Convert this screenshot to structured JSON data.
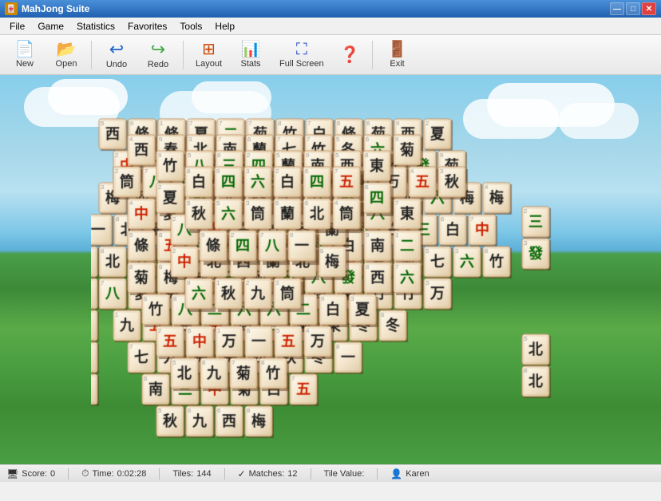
{
  "window": {
    "title": "MahJong Suite",
    "icon": "🀄"
  },
  "title_controls": {
    "minimize": "—",
    "maximize": "□",
    "close": "✕"
  },
  "menu": {
    "items": [
      "File",
      "Game",
      "Statistics",
      "Favorites",
      "Tools",
      "Help"
    ]
  },
  "toolbar": {
    "buttons": [
      {
        "label": "New",
        "icon": "📄",
        "name": "new-button"
      },
      {
        "label": "Open",
        "icon": "📂",
        "name": "open-button"
      },
      {
        "label": "Undo",
        "icon": "↩",
        "name": "undo-button"
      },
      {
        "label": "Redo",
        "icon": "↪",
        "name": "redo-button"
      },
      {
        "label": "Layout",
        "icon": "⊞",
        "name": "layout-button"
      },
      {
        "label": "Stats",
        "icon": "📊",
        "name": "stats-button"
      },
      {
        "label": "Full Screen",
        "icon": "⛶",
        "name": "fullscreen-button"
      },
      {
        "label": "?",
        "icon": "❓",
        "name": "help-button"
      },
      {
        "label": "Exit",
        "icon": "🚪",
        "name": "exit-button"
      }
    ]
  },
  "status": {
    "score_label": "Score:",
    "score_value": "0",
    "time_label": "Time:",
    "time_value": "0:02:28",
    "tiles_label": "Tiles:",
    "tiles_value": "144",
    "matches_label": "Matches:",
    "matches_value": "12",
    "tile_value_label": "Tile Value:",
    "user_label": "Karen"
  }
}
